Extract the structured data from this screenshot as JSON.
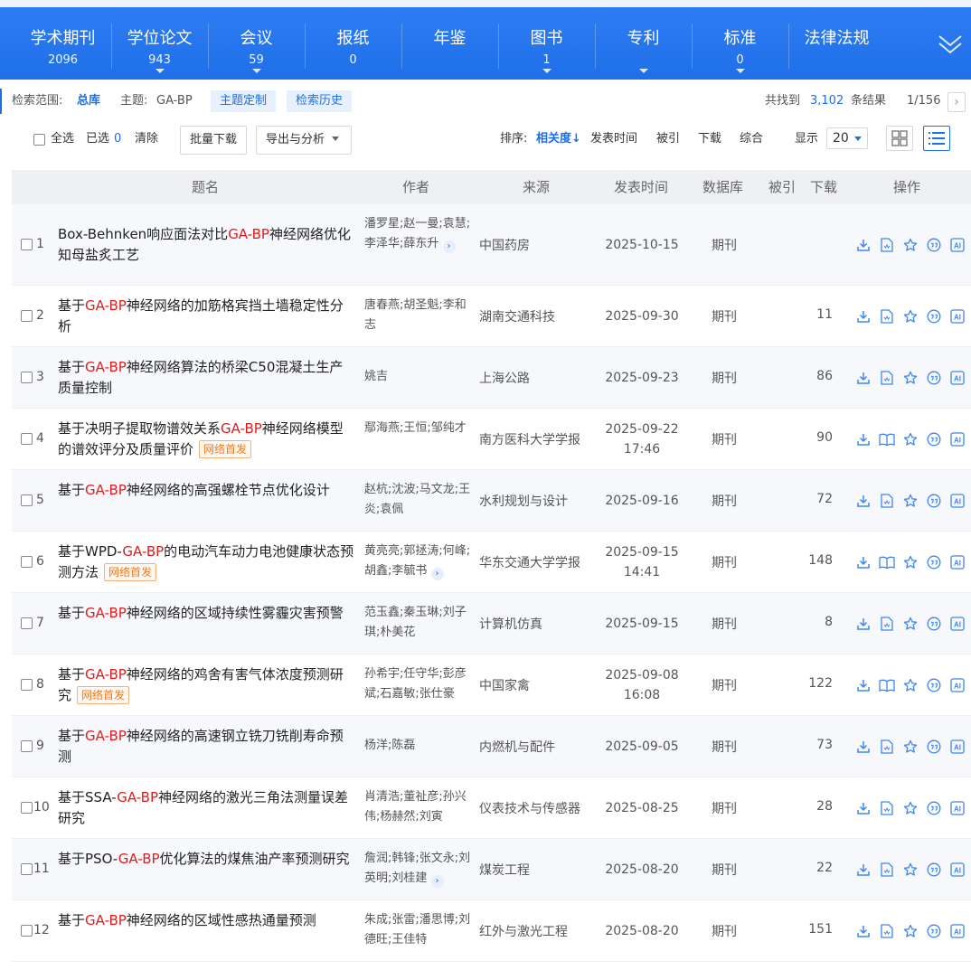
{
  "tabs": [
    {
      "label": "学术期刊",
      "count": "2096",
      "caret": false
    },
    {
      "label": "学位论文",
      "count": "943",
      "caret": true
    },
    {
      "label": "会议",
      "count": "59",
      "caret": true
    },
    {
      "label": "报纸",
      "count": "0",
      "caret": false
    },
    {
      "label": "年鉴",
      "count": "",
      "caret": false
    },
    {
      "label": "图书",
      "count": "1",
      "caret": true
    },
    {
      "label": "专利",
      "count": "",
      "caret": true
    },
    {
      "label": "标准",
      "count": "0",
      "caret": true
    },
    {
      "label": "法律法规",
      "count": "",
      "caret": false
    }
  ],
  "search": {
    "scope_label": "检索范围:",
    "scope_value": "总库",
    "topic_label": "主题:",
    "topic_value": "GA-BP",
    "custom_topic": "主题定制",
    "history": "检索历史",
    "found_prefix": "共找到",
    "found_count": "3,102",
    "found_suffix": "条结果",
    "page": "1/156",
    "next": "›"
  },
  "toolbar": {
    "select_all": "全选",
    "selected_label": "已选",
    "selected_count": "0",
    "clear": "清除",
    "batch_download": "批量下载",
    "export": "导出与分析",
    "sort_label": "排序:",
    "sort_relevance": "相关度",
    "sort_date": "发表时间",
    "sort_cited": "被引",
    "sort_download": "下载",
    "sort_combined": "综合",
    "display_label": "显示",
    "display_value": "20"
  },
  "table": {
    "headers": {
      "title": "题名",
      "author": "作者",
      "source": "来源",
      "date": "发表时间",
      "database": "数据库",
      "cited": "被引",
      "download": "下载",
      "actions": "操作"
    },
    "rows": [
      {
        "num": "1",
        "title": [
          "Box-Behnken响应面法对比",
          "GA-BP",
          "神经网络优化知母盐炙工艺"
        ],
        "badge": "",
        "authors": "潘罗星;赵一曼;袁慧;李泽华;薛东升",
        "more": true,
        "source": "中国药房",
        "date": "2025-10-15",
        "time": "",
        "database": "期刊",
        "download": "",
        "pdf": false
      },
      {
        "num": "2",
        "title": [
          "基于",
          "GA-BP",
          "神经网络的加筋格宾挡土墙稳定性分析"
        ],
        "badge": "",
        "authors": "唐春燕;胡圣魁;李和志",
        "more": false,
        "source": "湖南交通科技",
        "date": "2025-09-30",
        "time": "",
        "database": "期刊",
        "download": "11",
        "pdf": false
      },
      {
        "num": "3",
        "title": [
          "基于",
          "GA-BP",
          "神经网络算法的桥梁C50混凝土生产质量控制"
        ],
        "badge": "",
        "authors": "姚吉",
        "more": false,
        "source": "上海公路",
        "date": "2025-09-23",
        "time": "",
        "database": "期刊",
        "download": "86",
        "pdf": false
      },
      {
        "num": "4",
        "title": [
          "基于决明子提取物谱效关系",
          "GA-BP",
          "神经网络模型的谱效评分及质量评价"
        ],
        "badge": "网络首发",
        "authors": "鄢海燕;王恒;邹纯才",
        "more": false,
        "source": "南方医科大学学报",
        "date": "2025-09-22",
        "time": "17:46",
        "database": "期刊",
        "download": "90",
        "pdf": true
      },
      {
        "num": "5",
        "title": [
          "基于",
          "GA-BP",
          "神经网络的高强螺栓节点优化设计"
        ],
        "badge": "",
        "authors": "赵杭;沈波;马文龙;王炎;袁佩",
        "more": false,
        "source": "水利规划与设计",
        "date": "2025-09-16",
        "time": "",
        "database": "期刊",
        "download": "72",
        "pdf": false
      },
      {
        "num": "6",
        "title": [
          "基于WPD-",
          "GA-BP",
          "的电动汽车动力电池健康状态预测方法"
        ],
        "badge": "网络首发",
        "authors": "黄亮亮;郭拯涛;何峰;胡鑫;李毓书",
        "more": true,
        "source": "华东交通大学学报",
        "date": "2025-09-15",
        "time": "14:41",
        "database": "期刊",
        "download": "148",
        "pdf": true
      },
      {
        "num": "7",
        "title": [
          "基于",
          "GA-BP",
          "神经网络的区域持续性雾霾灾害预警"
        ],
        "badge": "",
        "authors": "范玉鑫;秦玉琳;刘子琪;朴美花",
        "more": false,
        "source": "计算机仿真",
        "date": "2025-09-15",
        "time": "",
        "database": "期刊",
        "download": "8",
        "pdf": false
      },
      {
        "num": "8",
        "title": [
          "基于",
          "GA-BP",
          "神经网络的鸡舍有害气体浓度预测研究"
        ],
        "badge": "网络首发",
        "authors": "孙希宇;任守华;彭彦斌;石嘉敏;张仕豪",
        "more": false,
        "source": "中国家禽",
        "date": "2025-09-08",
        "time": "16:08",
        "database": "期刊",
        "download": "122",
        "pdf": true
      },
      {
        "num": "9",
        "title": [
          "基于",
          "GA-BP",
          "神经网络的高速钢立铣刀铣削寿命预测"
        ],
        "badge": "",
        "authors": "杨洋;陈磊",
        "more": false,
        "source": "内燃机与配件",
        "date": "2025-09-05",
        "time": "",
        "database": "期刊",
        "download": "73",
        "pdf": false
      },
      {
        "num": "10",
        "title": [
          "基于SSA-",
          "GA-BP",
          "神经网络的激光三角法测量误差研究"
        ],
        "badge": "",
        "authors": "肖清浩;董祉彦;孙兴伟;杨赫然;刘寅",
        "more": false,
        "source": "仪表技术与传感器",
        "date": "2025-08-25",
        "time": "",
        "database": "期刊",
        "download": "28",
        "pdf": false
      },
      {
        "num": "11",
        "title": [
          "基于PSO-",
          "GA-BP",
          "优化算法的煤焦油产率预测研究"
        ],
        "badge": "",
        "authors": "詹润;韩锋;张文永;刘英明;刘桂建",
        "more": true,
        "source": "煤炭工程",
        "date": "2025-08-20",
        "time": "",
        "database": "期刊",
        "download": "22",
        "pdf": false
      },
      {
        "num": "12",
        "title": [
          "基于",
          "GA-BP",
          "神经网络的区域性感热通量预测"
        ],
        "badge": "",
        "authors": "朱成;张雷;潘思博;刘德旺;王佳特",
        "more": false,
        "source": "红外与激光工程",
        "date": "2025-08-20",
        "time": "",
        "database": "期刊",
        "download": "151",
        "pdf": false
      }
    ]
  },
  "colors": {
    "brand": "#1f6fe8",
    "highlight": "#e01b1b",
    "badge": "#f07a20"
  }
}
